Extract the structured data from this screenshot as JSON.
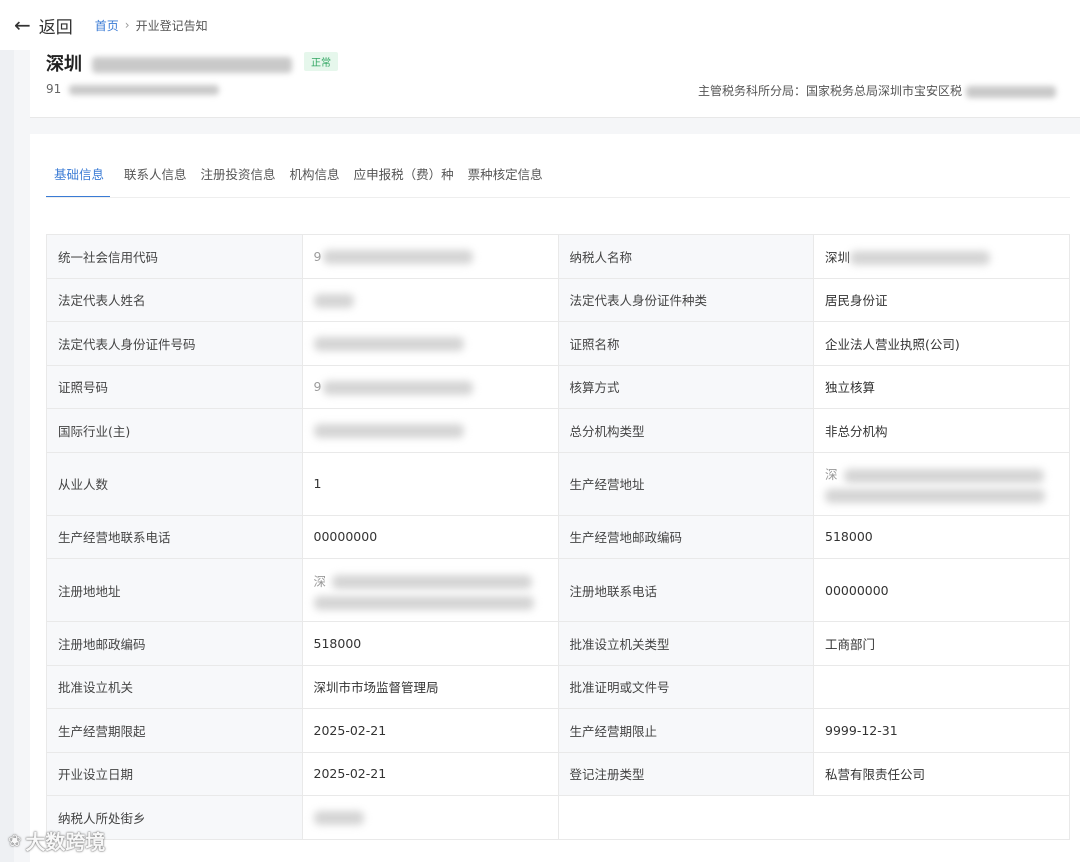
{
  "topbar": {
    "back_label": "返回",
    "breadcrumb": {
      "home": "首页",
      "sep": "›",
      "current": "开业登记告知"
    }
  },
  "summary": {
    "name_prefix": "深圳",
    "status": "正常",
    "code_prefix": "91",
    "tax_office_label": "主管税务科所分局：国家税务总局深圳市宝安区税"
  },
  "tabs": [
    {
      "label": "基础信息"
    },
    {
      "label": "联系人信息"
    },
    {
      "label": "注册投资信息"
    },
    {
      "label": "机构信息"
    },
    {
      "label": "应申报税（费）种"
    },
    {
      "label": "票种核定信息"
    }
  ],
  "rows": [
    {
      "l1": "统一社会信用代码",
      "v1": "9",
      "l2": "纳税人名称",
      "v2": "深圳"
    },
    {
      "l1": "法定代表人姓名",
      "v1": "",
      "l2": "法定代表人身份证件种类",
      "v2": "居民身份证"
    },
    {
      "l1": "法定代表人身份证件号码",
      "v1": "",
      "l2": "证照名称",
      "v2": "企业法人营业执照(公司)"
    },
    {
      "l1": "证照号码",
      "v1": "9",
      "l2": "核算方式",
      "v2": "独立核算"
    },
    {
      "l1": "国际行业(主)",
      "v1": "",
      "l2": "总分机构类型",
      "v2": "非总分机构"
    },
    {
      "l1": "从业人数",
      "v1": "1",
      "l2": "生产经营地址",
      "v2": "深"
    },
    {
      "l1": "生产经营地联系电话",
      "v1": "00000000",
      "l2": "生产经营地邮政编码",
      "v2": "518000"
    },
    {
      "l1": "注册地地址",
      "v1": "深",
      "l2": "注册地联系电话",
      "v2": "00000000"
    },
    {
      "l1": "注册地邮政编码",
      "v1": "518000",
      "l2": "批准设立机关类型",
      "v2": "工商部门"
    },
    {
      "l1": "批准设立机关",
      "v1": "深圳市市场监督管理局",
      "l2": "批准证明或文件号",
      "v2": ""
    },
    {
      "l1": "生产经营期限起",
      "v1": "2025-02-21",
      "l2": "生产经营期限止",
      "v2": "9999-12-31"
    },
    {
      "l1": "开业设立日期",
      "v1": "2025-02-21",
      "l2": "登记注册类型",
      "v2": "私营有限责任公司"
    },
    {
      "l1": "纳税人所处街乡",
      "v1": "",
      "l2": "",
      "v2": ""
    }
  ],
  "watermark": "大数跨境"
}
